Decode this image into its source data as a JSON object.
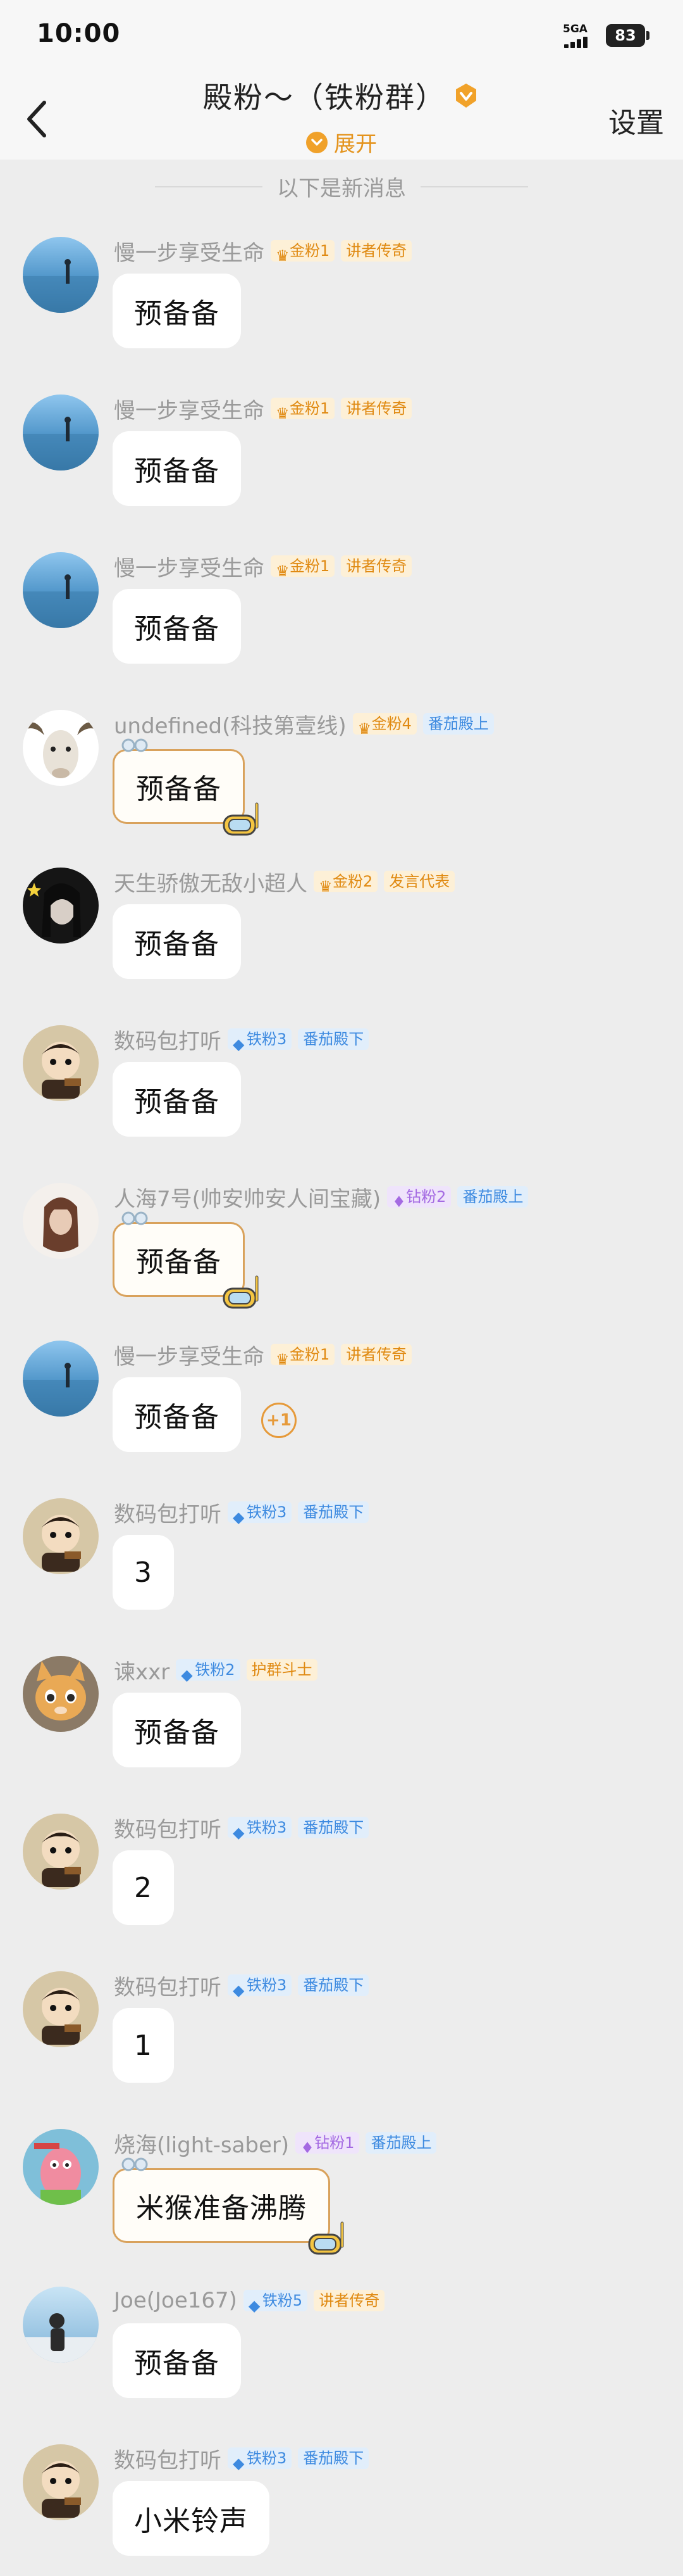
{
  "status": {
    "time": "10:00",
    "network": "5GA",
    "battery": "83"
  },
  "header": {
    "title": "殿粉～（铁粉群）",
    "expand_label": "展开",
    "settings_label": "设置"
  },
  "divider": "以下是新消息",
  "messages": [
    {
      "name": "慢一步享受生命",
      "badges": [
        {
          "text": "金粉1",
          "kind": "gold"
        },
        {
          "text": "讲者传奇",
          "kind": "orange"
        }
      ],
      "text": "预备备"
    },
    {
      "name": "慢一步享受生命",
      "badges": [
        {
          "text": "金粉1",
          "kind": "gold"
        },
        {
          "text": "讲者传奇",
          "kind": "orange"
        }
      ],
      "text": "预备备"
    },
    {
      "name": "慢一步享受生命",
      "badges": [
        {
          "text": "金粉1",
          "kind": "gold"
        },
        {
          "text": "讲者传奇",
          "kind": "orange"
        }
      ],
      "text": "预备备"
    },
    {
      "name": "undefined(科技第壹线)",
      "badges": [
        {
          "text": "金粉4",
          "kind": "gold"
        },
        {
          "text": "番茄殿上",
          "kind": "blue"
        }
      ],
      "text": "预备备"
    },
    {
      "name": "天生骄傲无敌小超人",
      "badges": [
        {
          "text": "金粉2",
          "kind": "gold"
        },
        {
          "text": "发言代表",
          "kind": "orange"
        }
      ],
      "text": "预备备"
    },
    {
      "name": "数码包打听",
      "badges": [
        {
          "text": "铁粉3",
          "kind": "iron"
        },
        {
          "text": "番茄殿下",
          "kind": "blue"
        }
      ],
      "text": "预备备"
    },
    {
      "name": "人海7号(帅安帅安人间宝藏)",
      "badges": [
        {
          "text": "钻粉2",
          "kind": "diam"
        },
        {
          "text": "番茄殿上",
          "kind": "blue"
        }
      ],
      "text": "预备备"
    },
    {
      "name": "慢一步享受生命",
      "badges": [
        {
          "text": "金粉1",
          "kind": "gold"
        },
        {
          "text": "讲者传奇",
          "kind": "orange"
        }
      ],
      "text": "预备备",
      "plus": "+1"
    },
    {
      "name": "数码包打听",
      "badges": [
        {
          "text": "铁粉3",
          "kind": "iron"
        },
        {
          "text": "番茄殿下",
          "kind": "blue"
        }
      ],
      "text": "3"
    },
    {
      "name": "谏xxr",
      "badges": [
        {
          "text": "铁粉2",
          "kind": "iron"
        },
        {
          "text": "护群斗士",
          "kind": "orange"
        }
      ],
      "text": "预备备"
    },
    {
      "name": "数码包打听",
      "badges": [
        {
          "text": "铁粉3",
          "kind": "iron"
        },
        {
          "text": "番茄殿下",
          "kind": "blue"
        }
      ],
      "text": "2"
    },
    {
      "name": "数码包打听",
      "badges": [
        {
          "text": "铁粉3",
          "kind": "iron"
        },
        {
          "text": "番茄殿下",
          "kind": "blue"
        }
      ],
      "text": "1"
    },
    {
      "name": "烧海(light-saber)",
      "badges": [
        {
          "text": "钻粉1",
          "kind": "diam"
        },
        {
          "text": "番茄殿上",
          "kind": "blue"
        }
      ],
      "text": "米猴准备沸腾"
    },
    {
      "name": "Joe(Joe167)",
      "badges": [
        {
          "text": "铁粉5",
          "kind": "iron"
        },
        {
          "text": "讲者传奇",
          "kind": "orange"
        }
      ],
      "text": "预备备"
    },
    {
      "name": "数码包打听",
      "badges": [
        {
          "text": "铁粉3",
          "kind": "iron"
        },
        {
          "text": "番茄殿下",
          "kind": "blue"
        }
      ],
      "text": "小米铃声"
    }
  ]
}
